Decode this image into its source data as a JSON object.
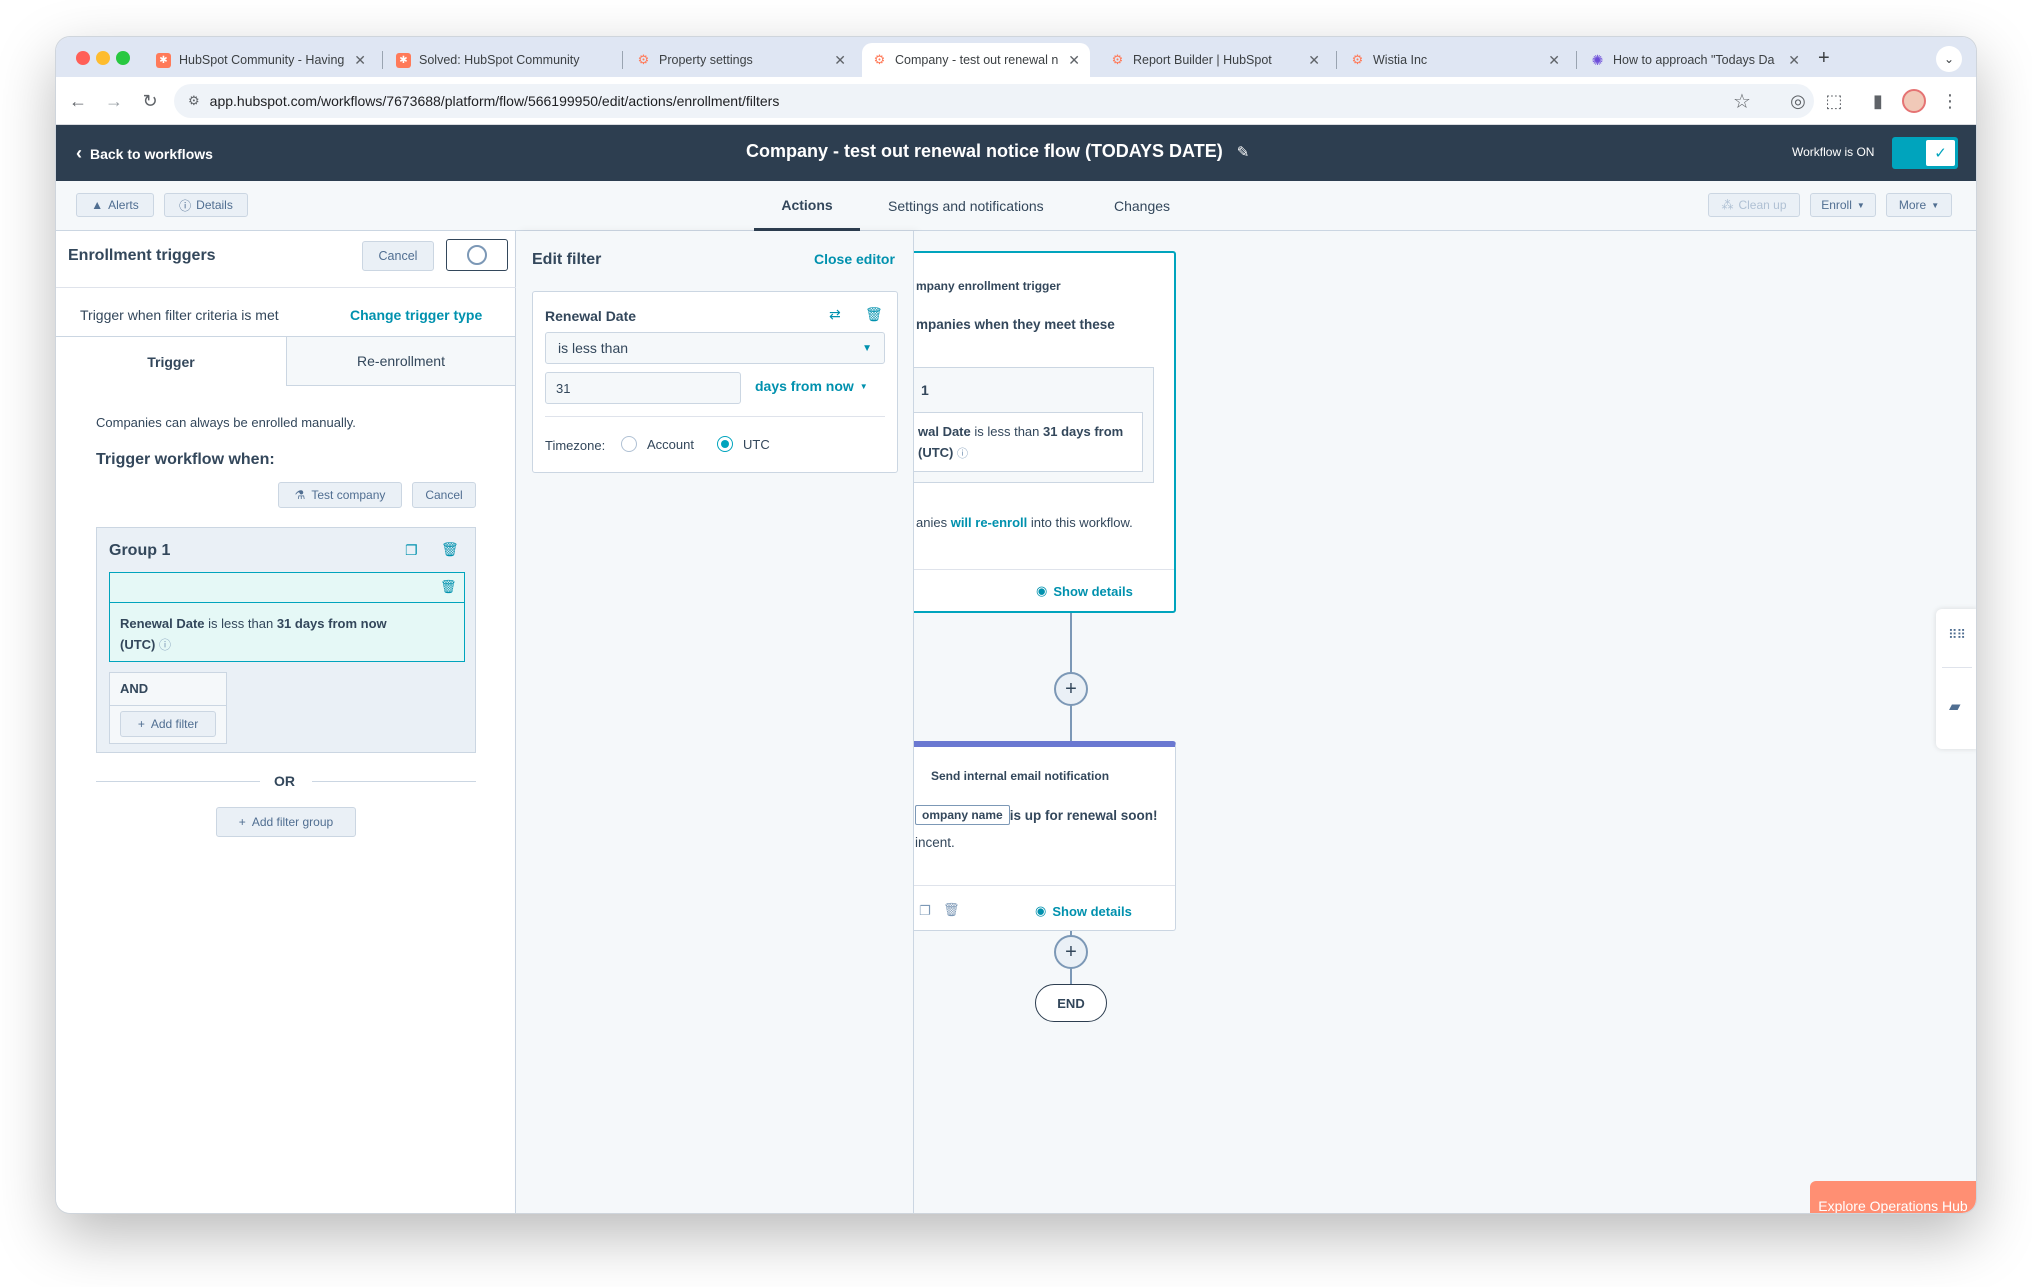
{
  "browser": {
    "tabs": [
      {
        "title": "HubSpot Community - Having",
        "favicon_color": "#ff7a59"
      },
      {
        "title": "Solved: HubSpot Community",
        "favicon_color": "#ff7a59"
      },
      {
        "title": "Property settings",
        "favicon_color": "#ff7a59"
      },
      {
        "title": "Company - test out renewal n",
        "favicon_color": "#ff7a59",
        "active": true
      },
      {
        "title": "Report Builder | HubSpot",
        "favicon_color": "#ff7a59"
      },
      {
        "title": "Wistia Inc",
        "favicon_color": "#ff7a59"
      },
      {
        "title": "How to approach \"Todays Da",
        "favicon_color": "#6c4cd9"
      }
    ],
    "new_tab_label": "+",
    "url": "app.hubspot.com/workflows/7673688/platform/flow/566199950/edit/actions/enrollment/filters"
  },
  "header": {
    "back_label": "Back to workflows",
    "workflow_title": "Company - test out renewal notice flow (TODAYS DATE)",
    "workflow_status": "Workflow is ON",
    "toggle_color": "#00a4bd"
  },
  "subnav": {
    "alerts_label": "Alerts",
    "details_label": "Details",
    "tabs": [
      "Actions",
      "Settings and notifications",
      "Changes"
    ],
    "cleanup_label": "Clean up",
    "enroll_label": "Enroll",
    "more_label": "More"
  },
  "enrollment": {
    "title": "Enrollment triggers",
    "cancel_label": "Cancel",
    "trigger_desc": "Trigger when filter criteria is met",
    "change_trigger_label": "Change trigger type",
    "tabs": [
      "Trigger",
      "Re-enrollment"
    ],
    "manual_note": "Companies can always be enrolled manually.",
    "trigger_heading": "Trigger workflow when:",
    "test_company_label": "Test company",
    "cancel2_label": "Cancel",
    "group_title": "Group 1",
    "filter_property": "Renewal Date",
    "filter_operator": " is less than ",
    "filter_value": "31 days from now",
    "filter_tz": "(UTC)",
    "and_label": "AND",
    "add_filter_label": "Add filter",
    "or_label": "OR",
    "add_filter_group_label": "Add filter group"
  },
  "edit_filter": {
    "title": "Edit filter",
    "close_label": "Close editor",
    "property": "Renewal Date",
    "operator": "is less than",
    "value": "31",
    "unit": "days from now",
    "timezone_label": "Timezone:",
    "tz_options": [
      "Account",
      "UTC"
    ],
    "tz_selected": "UTC"
  },
  "canvas": {
    "trigger_card": {
      "heading": "mpany enrollment trigger",
      "desc": "mpanies when they meet these",
      "group_label": "1",
      "filter_prop": "wal Date",
      "filter_op": " is less than ",
      "filter_val": "31 days from",
      "filter_tz": "(UTC)",
      "reenroll_pre": "anies ",
      "reenroll_link": "will re-enroll",
      "reenroll_post": " into this workflow.",
      "show_details": "Show details"
    },
    "action_card": {
      "heading": "Send internal email notification",
      "token": "ompany name",
      "body_rest": " is up for renewal soon!",
      "line2": "incent.",
      "show_details": "Show details",
      "accent_color": "#6a78d1"
    },
    "end_label": "END"
  },
  "cta": {
    "label": "Explore Operations Hub",
    "color": "#ff8f73"
  }
}
